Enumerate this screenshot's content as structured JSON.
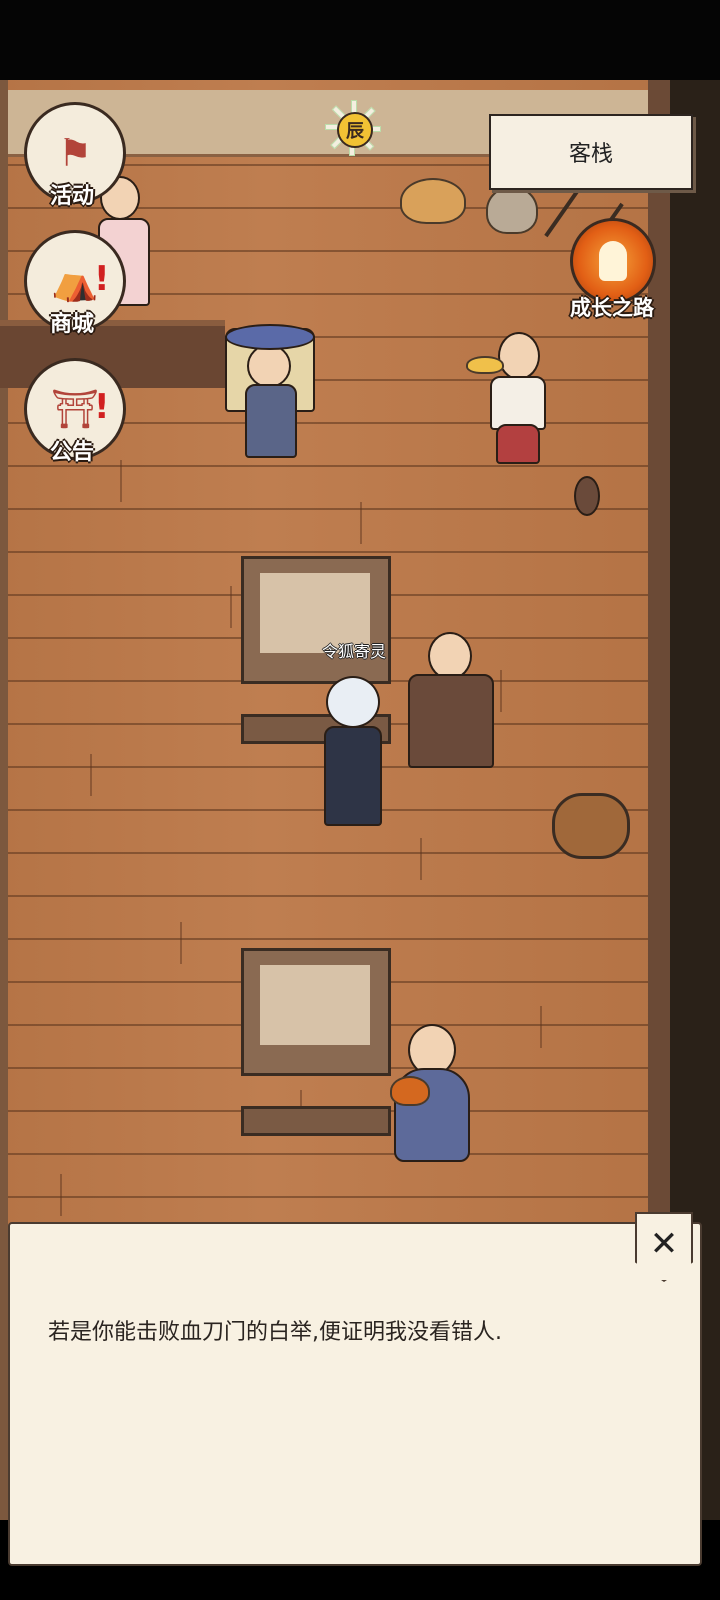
{
  "game": {
    "location": "客栈",
    "time_of_day": "辰"
  },
  "side_menu": [
    {
      "label": "活动",
      "icon": "activity-flag-icon",
      "alert": false
    },
    {
      "label": "商城",
      "icon": "shop-stall-icon",
      "alert": true
    },
    {
      "label": "公告",
      "icon": "notice-board-icon",
      "alert": true
    }
  ],
  "growth": {
    "label": "成长之路",
    "icon": "growth-path-icon"
  },
  "npc": {
    "name": "令狐寄灵"
  },
  "dialog": {
    "text": "若是你能击败血刀门的白举,便证明我没看错人.",
    "close_glyph": "✕"
  },
  "colors": {
    "floor": "#b9784a",
    "dialog_bg": "#f8f1e2",
    "growth_orange": "#e25f15",
    "alert_red": "#d12020"
  }
}
